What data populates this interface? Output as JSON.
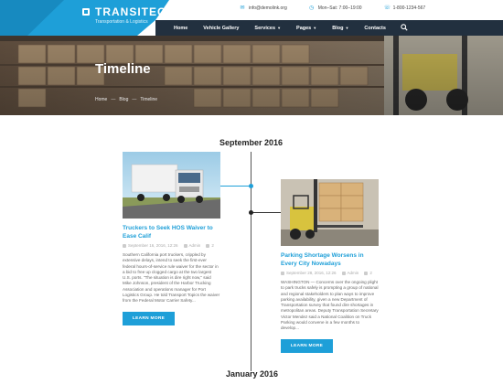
{
  "brand": {
    "name": "TRANSITEC",
    "tagline": "Transportation & Logistics",
    "accent": "#1e9fd8",
    "nav_bg": "#22303f"
  },
  "contacts": [
    {
      "icon": "mail-icon",
      "text": "info@demolink.org"
    },
    {
      "icon": "clock-icon",
      "text": "Mon–Sat: 7:00–19:00"
    },
    {
      "icon": "phone-icon",
      "text": "1-800-1234-567"
    }
  ],
  "nav": [
    {
      "label": "Home",
      "dropdown": false
    },
    {
      "label": "Vehicle Gallery",
      "dropdown": false
    },
    {
      "label": "Services",
      "dropdown": true
    },
    {
      "label": "Pages",
      "dropdown": true
    },
    {
      "label": "Blog",
      "dropdown": true
    },
    {
      "label": "Contacts",
      "dropdown": false
    }
  ],
  "hero": {
    "title": "Timeline",
    "breadcrumb": [
      "Home",
      "Blog",
      "Timeline"
    ]
  },
  "timeline": {
    "sections": [
      "September 2016",
      "January 2016"
    ],
    "posts": [
      {
        "title": "Truckers to Seek HOS Waiver to Ease Calif",
        "date": "September 16, 2016, 12:26",
        "author": "Admin",
        "comments": "2",
        "body": "Southern California port truckers, crippled by extensive delays, intend to seek the first-ever federal hours-of-service rule waiver for the sector in a bid to free up clogged cargo at the two largest U.S. ports. \"The situation is dire right now,\" said Mike Johnson, president of the Harbor Trucking Association and operations manager for Port Logistics Group. He told Transport Topics the waiver from the Federal Motor Carrier Safety...",
        "button": "LEARN MORE"
      },
      {
        "title": "Parking Shortage Worsens in Every City Nowadays",
        "date": "September 28, 2016, 12:26",
        "author": "Admin",
        "comments": "2",
        "body": "WASHINGTON — Concerns over the ongoing plight to park trucks safely is prompting a group of national and regional stakeholders to plan ways to improve parking availability, given a new Department of Transportation survey that found dire shortages in metropolitan areas. Deputy Transportation Secretary Victor Mendez said a National Coalition on Truck Parking would convene in a few months to develop...",
        "button": "LEARN MORE"
      }
    ]
  }
}
